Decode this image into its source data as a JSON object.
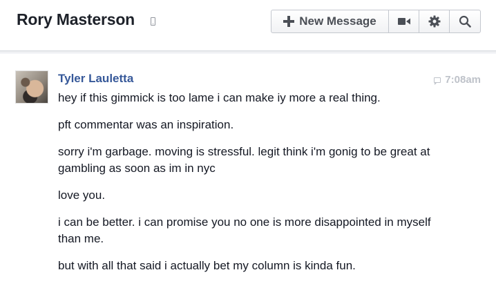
{
  "header": {
    "title": "Rory Masterson",
    "new_message_label": "New Message"
  },
  "message": {
    "sender": "Tyler Lauletta",
    "time": "7:08am",
    "paragraphs": [
      "hey if this gimmick is too lame i can make iy more a real thing.",
      "pft commentar was an inspiration.",
      "sorry i'm garbage. moving is stressful. legit think i'm gonig to be great at gambling as soon as im in nyc",
      "love you.",
      "i can be better. i can promise you no one is more disappointed in myself than me.",
      "but with all that said i actually bet my column is kinda fun."
    ]
  },
  "icons": {
    "mobile": "mobile-phone-icon",
    "plus": "plus-icon",
    "video": "video-camera-icon",
    "gear": "gear-icon",
    "search": "search-icon",
    "chat": "chat-bubble-icon"
  },
  "colors": {
    "sender_link": "#365899",
    "timestamp": "#bec2c9",
    "text": "#141823"
  }
}
